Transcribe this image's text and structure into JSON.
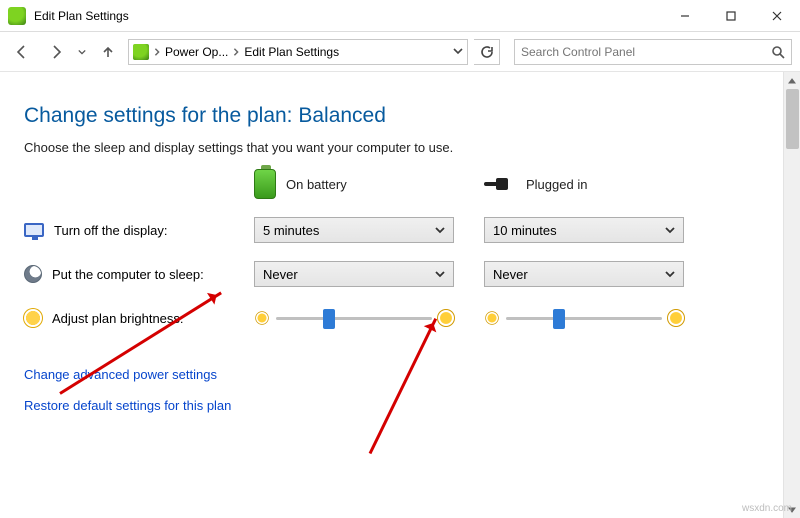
{
  "window": {
    "title": "Edit Plan Settings"
  },
  "toolbar": {
    "breadcrumb1": "Power Op...",
    "breadcrumb2": "Edit Plan Settings",
    "search_placeholder": "Search Control Panel"
  },
  "page": {
    "heading": "Change settings for the plan: Balanced",
    "description": "Choose the sleep and display settings that you want your computer to use.",
    "col_battery": "On battery",
    "col_plugged": "Plugged in",
    "row_display": "Turn off the display:",
    "row_sleep": "Put the computer to sleep:",
    "row_brightness": "Adjust plan brightness:",
    "display_battery": "5 minutes",
    "display_plugged": "10 minutes",
    "sleep_battery": "Never",
    "sleep_plugged": "Never",
    "link_advanced": "Change advanced power settings",
    "link_restore": "Restore default settings for this plan"
  },
  "watermark": "wsxdn.com"
}
